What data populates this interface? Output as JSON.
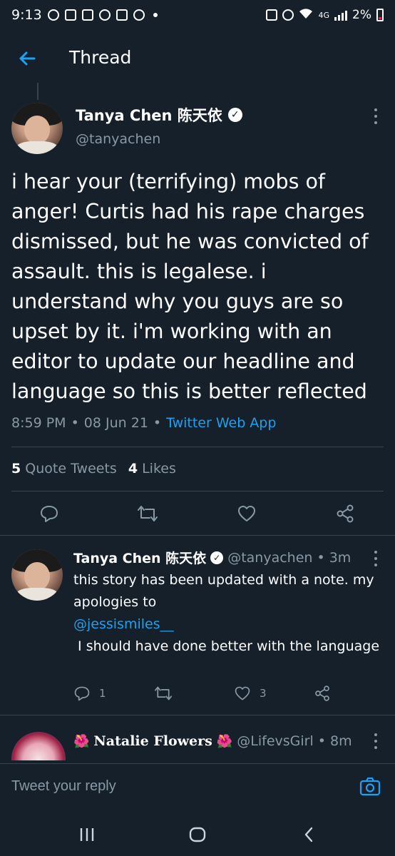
{
  "status_bar": {
    "time": "9:13",
    "network": "4G",
    "battery": "2%"
  },
  "header": {
    "title": "Thread"
  },
  "main_tweet": {
    "name": "Tanya Chen 陈天依",
    "handle": "@tanyachen",
    "text": "i hear your (terrifying) mobs of anger! Curtis had his rape charges dismissed, but he was convicted of assault. this is legalese. i understand why you guys are so upset by it. i'm working with an editor to update our headline and language so this is better reflected",
    "time": "8:59 PM",
    "date": "08 Jun 21",
    "source": "Twitter Web App",
    "sep": "•",
    "quote_tweets_count": "5",
    "quote_tweets_label": "Quote Tweets",
    "likes_count": "4",
    "likes_label": "Likes"
  },
  "reply": {
    "name": "Tanya Chen 陈天依",
    "meta": "@tanyachen • 3m",
    "text_line1": "this story has been updated with a note. my apologies to",
    "mention": "@jessismiles__",
    "text_line2": " I should have done better with the language",
    "reply_count": "1",
    "retweet_count": "",
    "like_count": "3"
  },
  "reply2": {
    "name": "Natalie Flowers",
    "flower_left": "🌺",
    "flower_right": "🌺",
    "meta": "@LifevsGirl • 8m"
  },
  "compose": {
    "placeholder": "Tweet your reply"
  },
  "colors": {
    "background": "#15202b",
    "accent": "#1da1f2",
    "secondary_text": "#8899a6",
    "divider": "#38444d"
  }
}
